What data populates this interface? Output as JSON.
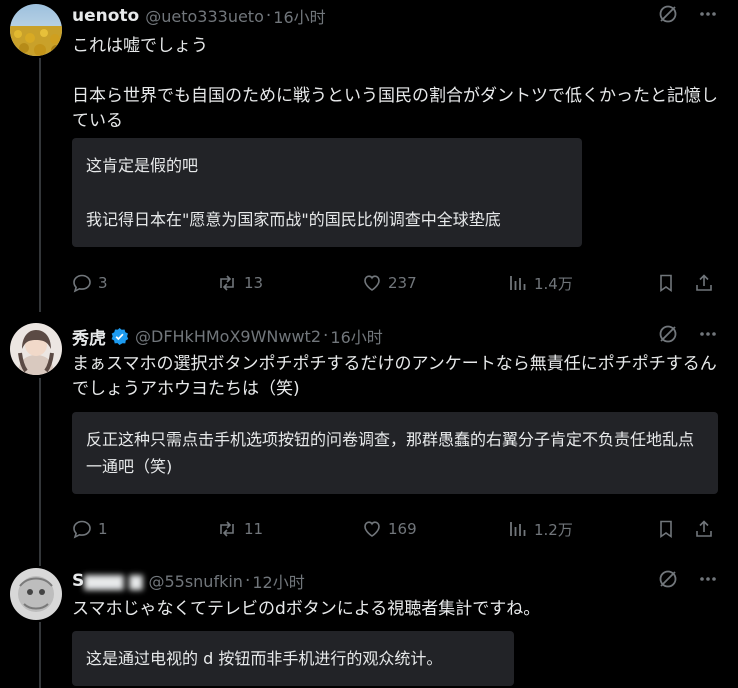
{
  "posts": [
    {
      "name": "uenoto",
      "handle": "@ueto333ueto",
      "time": "16小时",
      "text": "これは嘘でしょう\n\n日本ら世界でも自国のために戦うという国民の割合がダントツで低くかったと記憶している",
      "translation": "这肯定是假的吧\n\n我记得日本在\"愿意为国家而战\"的国民比例调查中全球垫底",
      "replies": "3",
      "reposts": "13",
      "likes": "237",
      "views": "1.4万"
    },
    {
      "name": "秀虎",
      "verified": true,
      "handle": "@DFHkHMoX9WNwwt2",
      "time": "16小时",
      "text": "まぁスマホの選択ボタンポチポチするだけのアンケートなら無責任にポチポチするんでしょうアホウヨたちは（笑)",
      "translation": "反正这种只需点击手机选项按钮的问卷调查，那群愚蠢的右翼分子肯定不负责任地乱点一通吧（笑)",
      "replies": "1",
      "reposts": "11",
      "likes": "169",
      "views": "1.2万"
    },
    {
      "name": "S",
      "handle": "@55snufkin",
      "time": "12小时",
      "text": "スマホじゃなくてテレビのdボタンによる視聴者集計ですね。",
      "translation": "这是通过电视的 d 按钮而非手机进行的观众统计。"
    }
  ],
  "dot": "·",
  "colors": {
    "background": "#000000",
    "text": "#e7e9ea",
    "muted": "#71767b",
    "verified": "#1d9bf0",
    "translation_bg": "#222327"
  },
  "icons": [
    "grok-icon",
    "more-icon",
    "reply-icon",
    "repost-icon",
    "like-icon",
    "views-icon",
    "bookmark-icon",
    "share-icon"
  ]
}
